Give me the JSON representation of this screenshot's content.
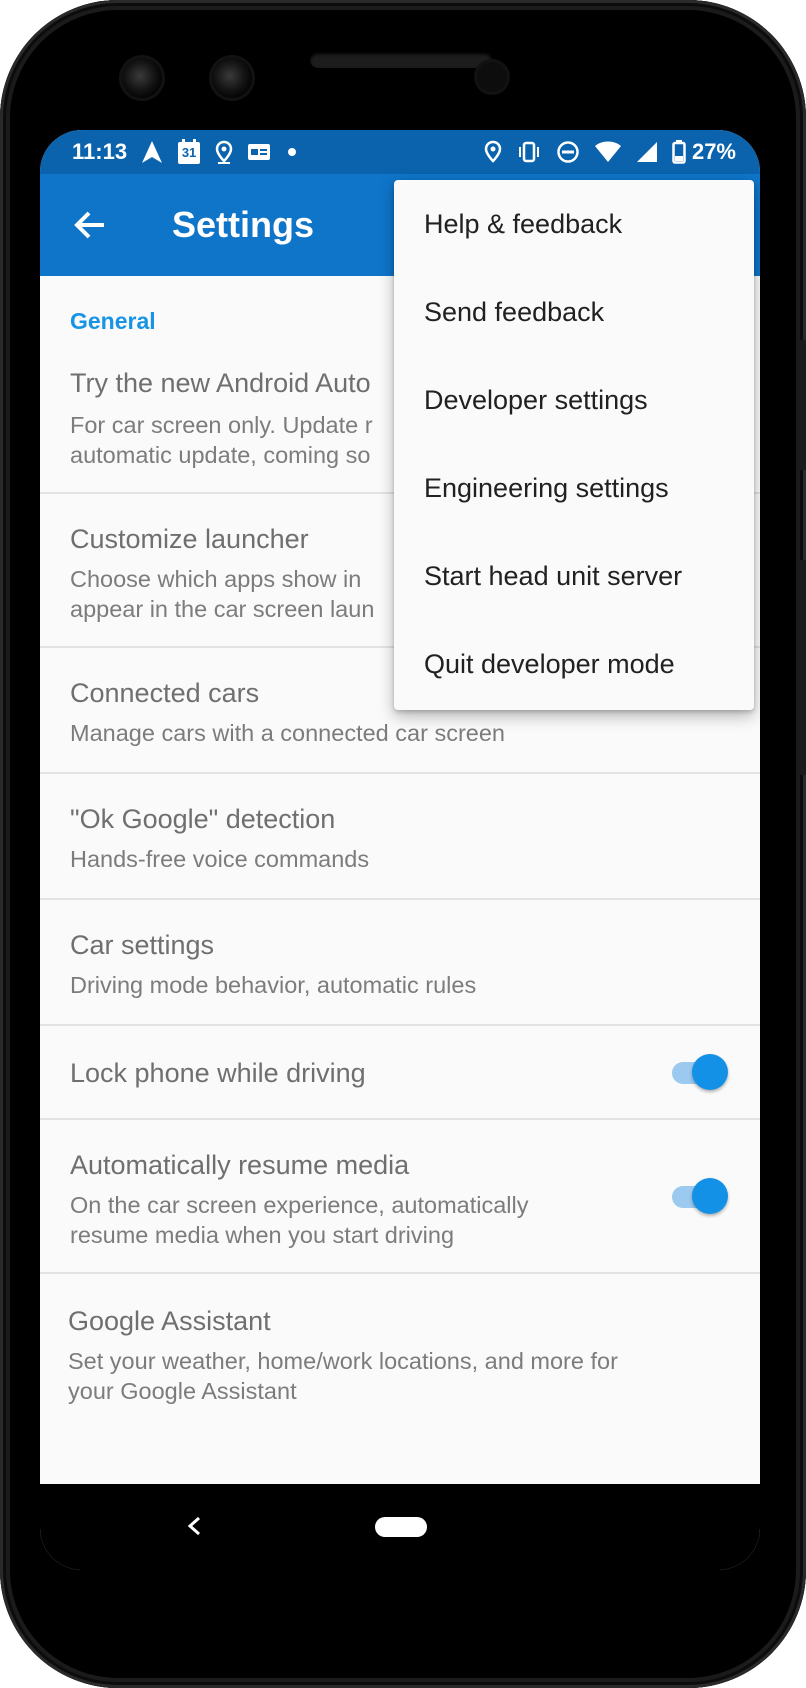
{
  "status_bar": {
    "time": "11:13",
    "calendar_day": "31",
    "battery": "27%",
    "left_icons": [
      "navigation-icon",
      "calendar-icon",
      "location-icon",
      "gmail-icon",
      "dot-icon"
    ],
    "right_icons": [
      "location-icon",
      "vibrate-icon",
      "do-not-disturb-icon",
      "wifi-icon",
      "signal-icon",
      "battery-icon"
    ]
  },
  "app_bar": {
    "title": "Settings",
    "back_icon": "arrow-back-icon",
    "background": "#0f75c9"
  },
  "settings": {
    "section_header": "General",
    "items": [
      {
        "title": "Try the new Android Auto",
        "subtitle_lines": [
          "For car screen only. Update r",
          "automatic update, coming so"
        ]
      },
      {
        "title": "Customize launcher",
        "subtitle_lines": [
          "Choose which apps show in",
          "appear in the car screen laun"
        ]
      },
      {
        "title": "Connected cars",
        "subtitle_lines": [
          "Manage cars with a connected car screen"
        ]
      },
      {
        "title": "\"Ok Google\" detection",
        "subtitle_lines": [
          "Hands-free voice commands"
        ]
      },
      {
        "title": "Car settings",
        "subtitle_lines": [
          "Driving mode behavior, automatic rules"
        ]
      },
      {
        "title": "Lock phone while driving",
        "subtitle_lines": [],
        "toggle": true
      },
      {
        "title": "Automatically resume media",
        "subtitle_lines": [
          "On the car screen experience, automatically",
          "resume media when you start driving"
        ],
        "toggle": true
      },
      {
        "title": "Google Assistant",
        "subtitle_lines": [
          "Set your weather, home/work locations, and more for",
          "your Google Assistant"
        ]
      }
    ]
  },
  "overflow_menu": {
    "items": [
      "Help & feedback",
      "Send feedback",
      "Developer settings",
      "Engineering settings",
      "Start head unit server",
      "Quit developer mode"
    ]
  },
  "nav_bar": {
    "back_icon": "nav-back-icon",
    "home_icon": "nav-home-pill"
  },
  "colors": {
    "status_bar": "#0b63ad",
    "accent": "#1794e5",
    "toggle_on": "#1391e6"
  }
}
